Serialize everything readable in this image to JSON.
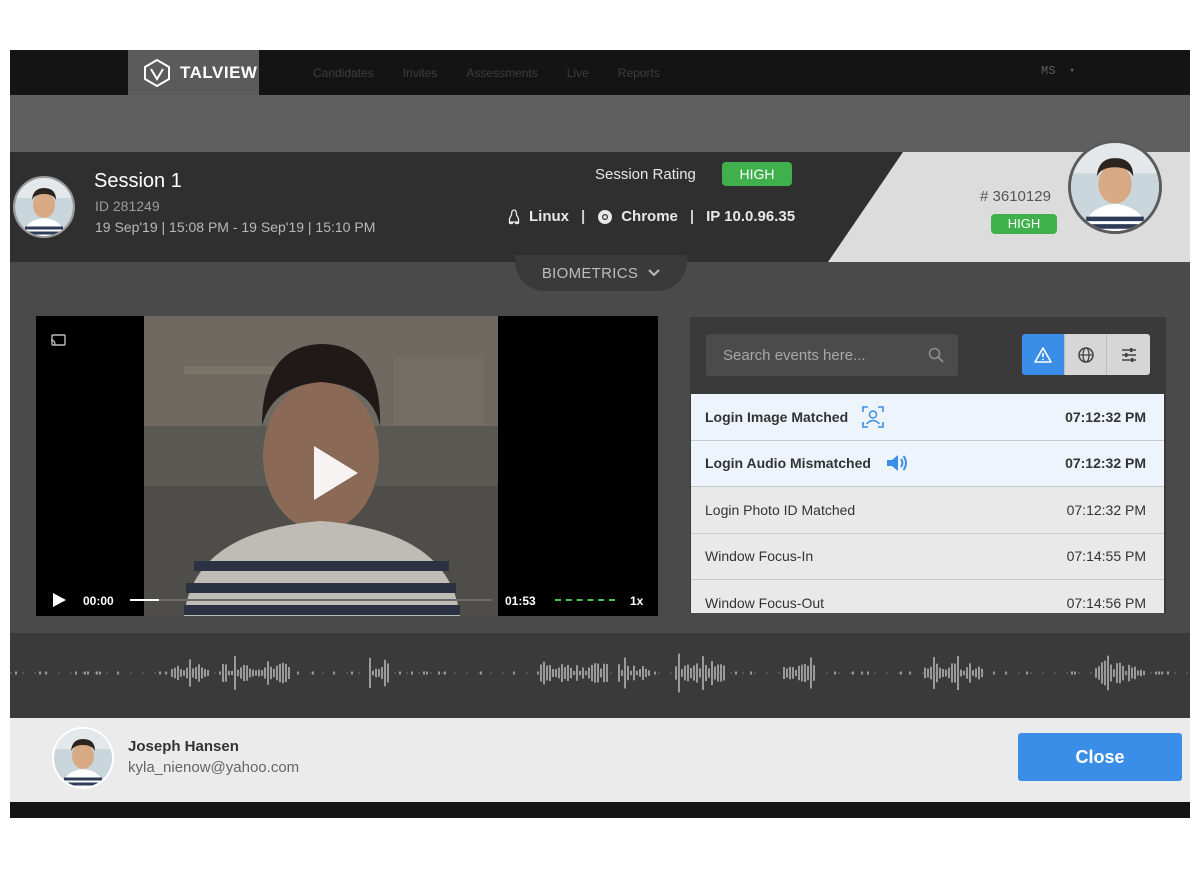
{
  "nav": {
    "brand": "TALVIEW",
    "items": [
      "Candidates",
      "Invites",
      "Assessments",
      "Live",
      "Reports"
    ],
    "user_initials": "MS",
    "user_caret": "▾"
  },
  "session": {
    "title": "Session 1",
    "id": "ID 281249",
    "time_range": "19 Sep'19 | 15:08 PM - 19 Sep'19 | 15:10 PM",
    "rating_label": "Session Rating",
    "rating_value": "HIGH",
    "os": "Linux",
    "browser": "Chrome",
    "ip": "IP 10.0.96.35",
    "separator": "|"
  },
  "candidate": {
    "code": "# 3610129",
    "rating": "HIGH"
  },
  "biometrics": {
    "label": "BIOMETRICS"
  },
  "video": {
    "current_time": "00:00",
    "duration": "01:53",
    "speed": "1x",
    "progress_fraction": 0.08
  },
  "events": {
    "search_placeholder": "Search events here...",
    "filters": [
      {
        "icon": "warning-icon",
        "active": true
      },
      {
        "icon": "globe-icon",
        "active": false
      },
      {
        "icon": "sliders-icon",
        "active": false
      }
    ],
    "rows": [
      {
        "label": "Login Image Matched",
        "time": "07:12:32 PM",
        "icon": "face-scan-icon",
        "highlight": true
      },
      {
        "label": "Login Audio Mismatched",
        "time": "07:12:32 PM",
        "icon": "speaker-icon",
        "highlight": true
      },
      {
        "label": "Login Photo ID Matched",
        "time": "07:12:32 PM",
        "icon": "",
        "highlight": false
      },
      {
        "label": "Window Focus-In",
        "time": "07:14:55 PM",
        "icon": "",
        "highlight": false
      },
      {
        "label": "Window Focus-Out",
        "time": "07:14:56 PM",
        "icon": "",
        "highlight": false
      }
    ]
  },
  "footer": {
    "name": "Joseph Hansen",
    "email": "kyla_nienow@yahoo.com",
    "close_label": "Close"
  },
  "colors": {
    "accent_blue": "#3b8ee8",
    "status_green": "#3fb04c",
    "panel_dark": "#2f2f2f"
  }
}
